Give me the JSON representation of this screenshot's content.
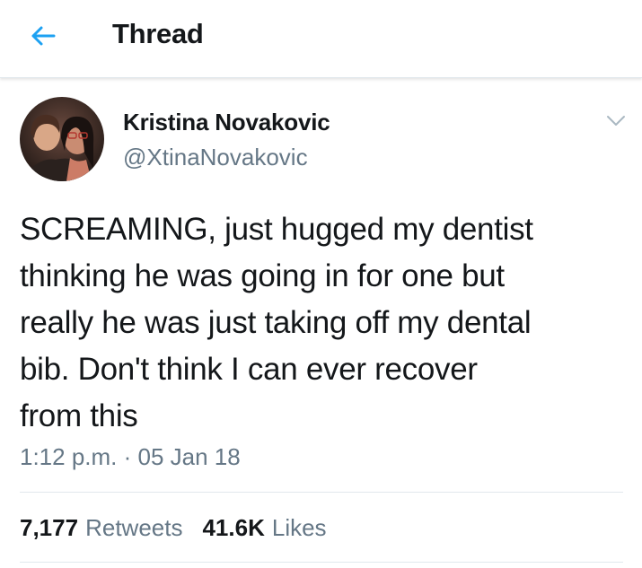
{
  "header": {
    "title": "Thread",
    "back_icon": "arrow-left-icon",
    "accent_color": "#1da1f2"
  },
  "tweet": {
    "author": {
      "name": "Kristina Novakovic",
      "handle": "@XtinaNovakovic"
    },
    "text": "SCREAMING, just hugged my dentist\nthinking he was going in for one but\nreally he was just taking off my dental\nbib. Don't think I can ever recover\nfrom this",
    "timestamp": "1:12 p.m. · 05 Jan 18",
    "menu_icon": "chevron-down-icon",
    "stats": {
      "retweets_count": "7,177",
      "retweets_label": "Retweets",
      "likes_count": "41.6K",
      "likes_label": "Likes"
    }
  },
  "colors": {
    "text_primary": "#14171a",
    "text_secondary": "#657786",
    "divider": "#e1e8ed"
  }
}
